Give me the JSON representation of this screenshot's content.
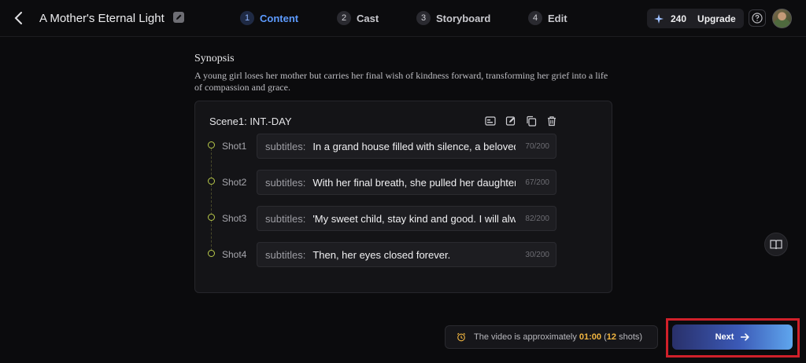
{
  "header": {
    "project_title": "A Mother's Eternal Light",
    "steps": [
      {
        "number": "1",
        "label": "Content",
        "active": true
      },
      {
        "number": "2",
        "label": "Cast",
        "active": false
      },
      {
        "number": "3",
        "label": "Storyboard",
        "active": false
      },
      {
        "number": "4",
        "label": "Edit",
        "active": false
      }
    ],
    "credits": "240",
    "upgrade_label": "Upgrade",
    "icons": {
      "back": "chevron-left-icon",
      "edit_title": "pencil-icon",
      "credits": "sparkle-icon",
      "help": "question-icon"
    }
  },
  "synopsis": {
    "heading": "Synopsis",
    "text": "A young girl loses her mother but carries her final wish of kindness forward, transforming her grief into a life of compassion and grace."
  },
  "scene": {
    "title": "Scene1: INT.-DAY",
    "tool_icons": [
      "image-icon",
      "edit-icon",
      "copy-icon",
      "trash-icon"
    ],
    "shots": [
      {
        "label": "Shot1",
        "prefix": "subtitles:",
        "text": "In a grand house filled with silence, a beloved",
        "count": "70/200"
      },
      {
        "label": "Shot2",
        "prefix": "subtitles:",
        "text": "With her final breath, she pulled her daughter",
        "count": "67/200"
      },
      {
        "label": "Shot3",
        "prefix": "subtitles:",
        "text": "'My sweet child, stay kind and good. I will always",
        "count": "82/200"
      },
      {
        "label": "Shot4",
        "prefix": "subtitles:",
        "text": "Then, her eyes closed forever.",
        "count": "30/200"
      }
    ]
  },
  "footer": {
    "info_prefix": "The video is approximately ",
    "duration": "01:00",
    "shots_open": " (",
    "shots_count": "12",
    "shots_suffix": " shots)",
    "next_label": "Next"
  },
  "colors": {
    "accent": "#5d9bff",
    "highlight": "#f2b640",
    "annotation_box": "#d0202a"
  }
}
